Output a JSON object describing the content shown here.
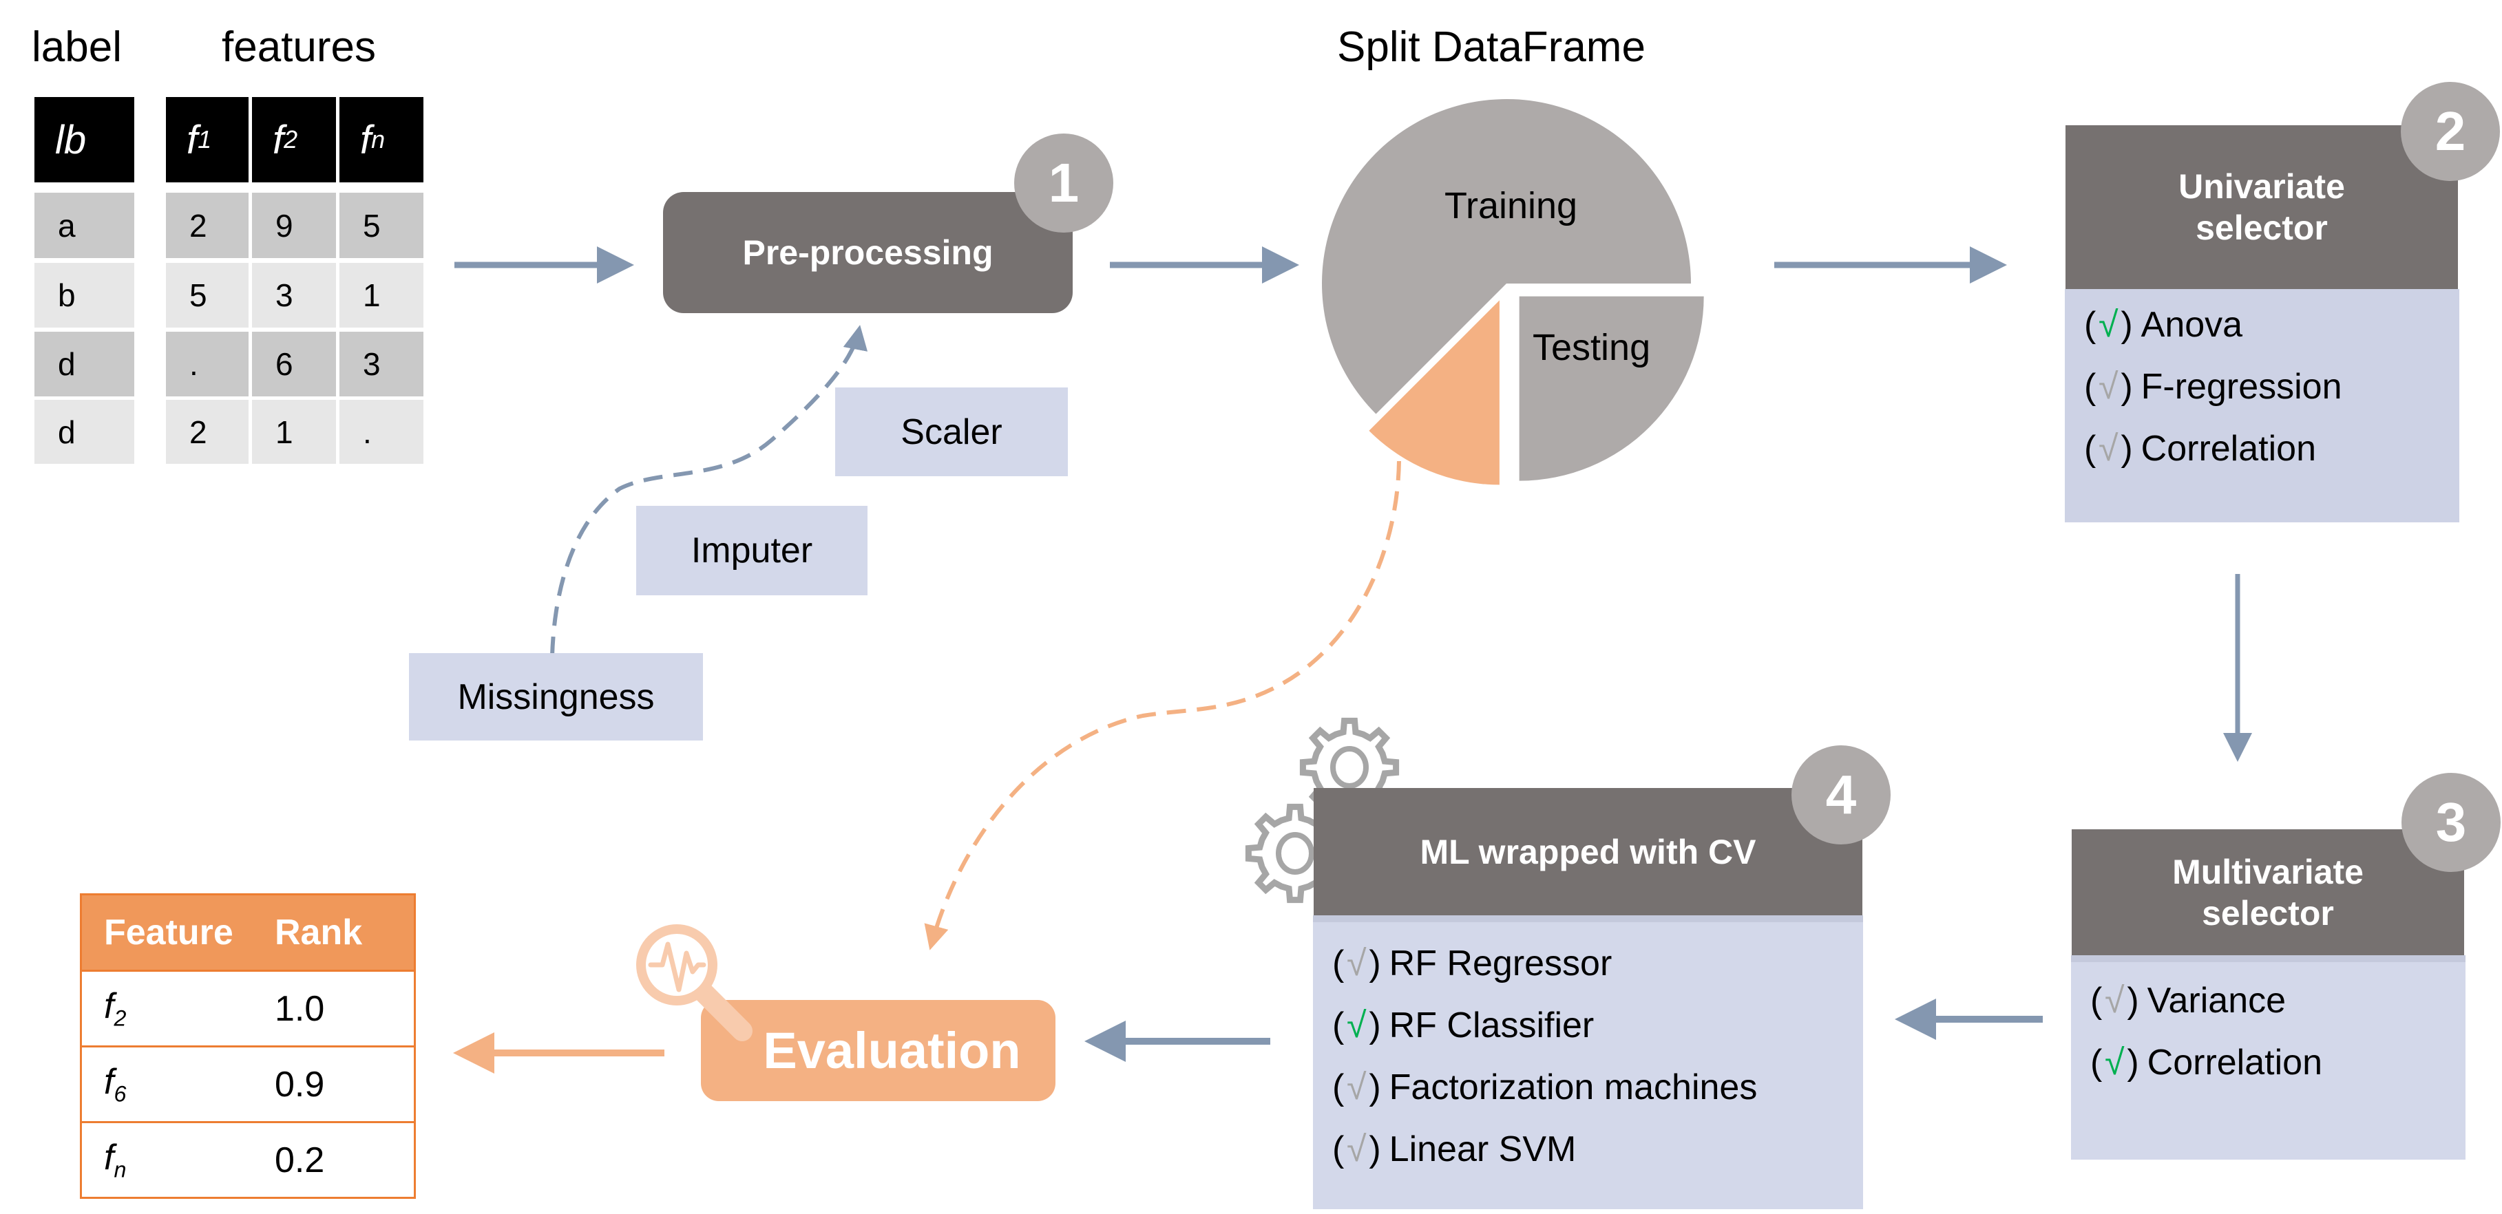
{
  "input_data": {
    "label_heading": "label",
    "features_heading": "features",
    "label_column": {
      "header": "lb",
      "values": [
        "a",
        "b",
        "d",
        "d"
      ]
    },
    "feature_columns": [
      {
        "name": "f",
        "sub": "1",
        "values": [
          "2",
          "5",
          ".",
          "2"
        ]
      },
      {
        "name": "f",
        "sub": "2",
        "values": [
          "9",
          "3",
          "6",
          "1"
        ]
      },
      {
        "name": "f",
        "sub": "n",
        "values": [
          "5",
          "1",
          "3",
          "."
        ]
      }
    ]
  },
  "preprocessing": {
    "title": "Pre-processing",
    "step": "1",
    "components": [
      {
        "label": "Scaler"
      },
      {
        "label": "Imputer"
      },
      {
        "label": "Missingness"
      }
    ]
  },
  "split": {
    "title": "Split DataFrame",
    "training_label": "Training",
    "testing_label": "Testing"
  },
  "chart_data": {
    "type": "pie",
    "title": "Split DataFrame",
    "slices": [
      {
        "label": "Training",
        "value": 62.5,
        "color": "#aeaaa9"
      },
      {
        "label": "Testing",
        "value": 25,
        "color": "#aeaaa9"
      },
      {
        "label": "",
        "value": 12.5,
        "color": "#f4b183"
      }
    ]
  },
  "univariate": {
    "step": "2",
    "title_line1": "Univariate",
    "title_line2": "selector",
    "options": [
      {
        "label": "Anova",
        "checked": true
      },
      {
        "label": "F-regression",
        "checked": false
      },
      {
        "label": "Correlation",
        "checked": false
      }
    ]
  },
  "multivariate": {
    "step": "3",
    "title_line1": "Multivariate",
    "title_line2": "selector",
    "options": [
      {
        "label": "Variance",
        "checked": false
      },
      {
        "label": "Correlation",
        "checked": true
      }
    ]
  },
  "ml": {
    "step": "4",
    "title": "ML wrapped with CV",
    "options": [
      {
        "label": "RF Regressor",
        "checked": false
      },
      {
        "label": "RF Classifier",
        "checked": true
      },
      {
        "label": "Factorization machines",
        "checked": false
      },
      {
        "label": "Linear SVM",
        "checked": false
      }
    ]
  },
  "evaluation": {
    "title": "Evaluation"
  },
  "ranking": {
    "headers": [
      "Feature",
      "Rank"
    ],
    "rows": [
      {
        "feature": "f",
        "sub": "2",
        "rank": "1.0"
      },
      {
        "feature": "f",
        "sub": "6",
        "rank": "0.9"
      },
      {
        "feature": "f",
        "sub": "n",
        "rank": "0.2"
      }
    ]
  },
  "check_glyph": "√",
  "paren_open": "(",
  "paren_close": ")",
  "colors": {
    "step_box": "#767170",
    "badge": "#aeaaa9",
    "panel": "#d3d8ea",
    "arrow": "#8497b0",
    "accent_orange": "#f4b183",
    "table_orange": "#ed7d31",
    "check_on": "#00b050",
    "check_off": "#a6a6a6"
  }
}
